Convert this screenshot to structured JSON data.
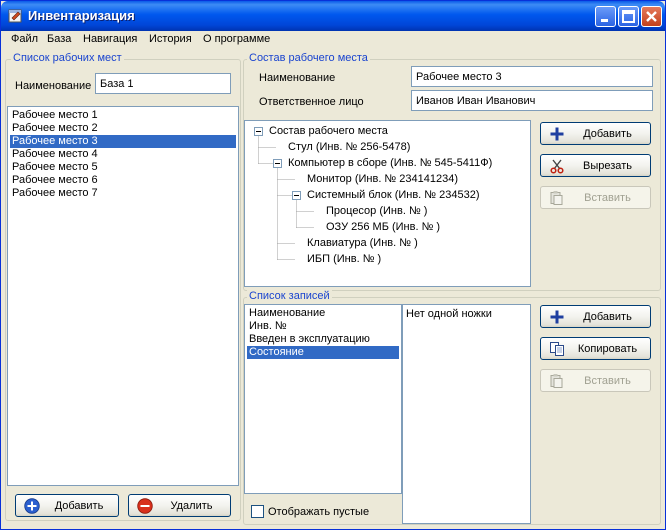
{
  "window": {
    "title": "Инвентаризация"
  },
  "menu": [
    "Файл",
    "База",
    "Навигация",
    "История",
    "О программе"
  ],
  "workplaces": {
    "caption": "Список рабочих мест",
    "name_label": "Наименование",
    "name_value": "База 1",
    "items": [
      "Рабочее место 1",
      "Рабочее место 2",
      "Рабочее место 3",
      "Рабочее место 4",
      "Рабочее место 5",
      "Рабочее место 6",
      "Рабочее место 7"
    ],
    "selected_index": 2,
    "add_label": "Добавить",
    "delete_label": "Удалить"
  },
  "composition": {
    "caption": "Состав рабочего места",
    "name_label": "Наименование",
    "name_value": "Рабочее место 3",
    "responsible_label": "Ответственное лицо",
    "responsible_value": "Иванов Иван Иванович",
    "tree": [
      {
        "label": "Состав рабочего места",
        "level": 0,
        "expander": "minus"
      },
      {
        "label": "Стул (Инв. № 256-5478)",
        "level": 1,
        "expander": "none"
      },
      {
        "label": "Компьютер в сборе (Инв. № 545-5411Ф)",
        "level": 1,
        "expander": "minus"
      },
      {
        "label": "Монитор (Инв. № 234141234)",
        "level": 2,
        "expander": "none"
      },
      {
        "label": "Системный блок (Инв. № 234532)",
        "level": 2,
        "expander": "minus"
      },
      {
        "label": "Процесор (Инв. № )",
        "level": 3,
        "expander": "none"
      },
      {
        "label": "ОЗУ 256 МБ (Инв. № )",
        "level": 3,
        "expander": "none"
      },
      {
        "label": "Клавиатура (Инв. № )",
        "level": 2,
        "expander": "none"
      },
      {
        "label": "ИБП (Инв. № )",
        "level": 2,
        "expander": "none"
      }
    ],
    "add_label": "Добавить",
    "cut_label": "Вырезать",
    "paste_label": "Вставить"
  },
  "records": {
    "caption": "Список записей",
    "fields": [
      "Наименование",
      "Инв. №",
      "Введен в эксплуатацию",
      "Состояние"
    ],
    "selected_index": 3,
    "value_text": "Нет одной ножки",
    "show_empty_label": "Отображать пустые",
    "show_empty_checked": false,
    "add_label": "Добавить",
    "copy_label": "Копировать",
    "paste_label": "Вставить"
  },
  "colors": {
    "accent": "#316ac5",
    "group_caption": "#1a44cf",
    "titlebar": "#0058ee"
  }
}
